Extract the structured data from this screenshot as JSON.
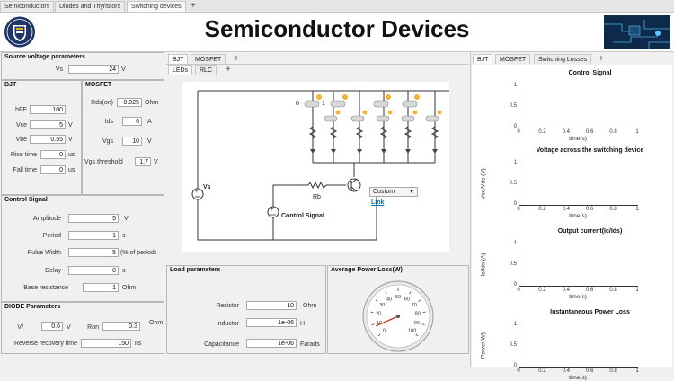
{
  "top_tabs": [
    "Semiconductors",
    "Diodes and Thyristors",
    "Switching devices"
  ],
  "header": {
    "title": "Semiconductor Devices"
  },
  "source": {
    "title": "Source voltage parameters",
    "vs_label": "Vs",
    "vs_value": "24",
    "vs_unit": "V"
  },
  "bjt": {
    "title": "BJT",
    "fields": [
      {
        "label": "hFE",
        "value": "100",
        "unit": ""
      },
      {
        "label": "Vce",
        "value": "5",
        "unit": "V"
      },
      {
        "label": "Vbe",
        "value": "0.55",
        "unit": "V"
      },
      {
        "label": "Rise time",
        "value": "0",
        "unit": "us"
      },
      {
        "label": "Fall time",
        "value": "0",
        "unit": "us"
      }
    ]
  },
  "mosfet": {
    "title": "MOSFET",
    "fields": [
      {
        "label": "Rds(on)",
        "value": "0.025",
        "unit": "Ohm"
      },
      {
        "label": "Ids",
        "value": "6",
        "unit": "A"
      },
      {
        "label": "Vgs",
        "value": "10",
        "unit": "V"
      },
      {
        "label": "Vgs  threshold",
        "value": "1.7",
        "unit": "V"
      }
    ]
  },
  "control_signal": {
    "title": "Control Signal",
    "fields": [
      {
        "label": "Amplitude",
        "value": "5",
        "unit": "V"
      },
      {
        "label": "Period",
        "value": "1",
        "unit": "s"
      },
      {
        "label": "Pulse Width",
        "value": "5",
        "unit": "(% of period)"
      },
      {
        "label": "Delay",
        "value": "0",
        "unit": "s"
      },
      {
        "label": "Base resistance",
        "value": "1",
        "unit": "Ohm"
      }
    ]
  },
  "diode": {
    "title": "DIODE Parameters",
    "vf_label": "Vf",
    "vf_value": "0.6",
    "vf_unit": "V",
    "ron_label": "Ron",
    "ron_value": "0.3",
    "ron_unit": "Ohm",
    "rrt_label": "Reverse recovery time",
    "rrt_value": "150",
    "rrt_unit": "ns"
  },
  "circuit_tabs": {
    "level1": [
      "BJT",
      "MOSFET"
    ],
    "level2": [
      "LEDs",
      "RLC"
    ]
  },
  "circuit": {
    "vs_label": "Vs",
    "rb_label": "Rb",
    "control_label": "Control Signal",
    "dropdown_value": "Custom",
    "link_text": "Link",
    "switch_zero": "0",
    "switch_one": "1"
  },
  "load": {
    "title": "Load parameters",
    "fields": [
      {
        "label": "Resistor",
        "value": "10",
        "unit": "Ohm"
      },
      {
        "label": "Inductor",
        "value": "1e-06",
        "unit": "H"
      },
      {
        "label": "Capacitance",
        "value": "1e-06",
        "unit": "Farads"
      }
    ]
  },
  "power": {
    "title": "Average Power Loss(W)",
    "gauge_labels": [
      "0",
      "10",
      "20",
      "30",
      "40",
      "50",
      "60",
      "70",
      "80",
      "90",
      "100"
    ],
    "gauge_value": 8,
    "gauge_min": 0,
    "gauge_max": 100
  },
  "right_tabs": [
    "BJT",
    "MOSFET",
    "Switching Losses"
  ],
  "plots": [
    {
      "title": "Control Signal",
      "ylabel": "",
      "yticks": [
        "1",
        "0.5",
        "0"
      ],
      "xticks": [
        "0",
        "0.2",
        "0.4",
        "0.6",
        "0.8",
        "1"
      ],
      "xlabel": "time(s)"
    },
    {
      "title": "Voltage across the switching device",
      "ylabel": "Vce/Vds (V)",
      "yticks": [
        "1",
        "0.5",
        "0"
      ],
      "xticks": [
        "0",
        "0.2",
        "0.4",
        "0.6",
        "0.8",
        "1"
      ],
      "xlabel": "time(s)"
    },
    {
      "title": "Output current(Ic/Ids)",
      "ylabel": "Ic/Ids (A)",
      "yticks": [
        "1",
        "0.5",
        "0"
      ],
      "xticks": [
        "0",
        "0.2",
        "0.4",
        "0.6",
        "0.8",
        "1"
      ],
      "xlabel": "time(s)"
    },
    {
      "title": "Instantaneous Power Loss",
      "ylabel": "Power(W)",
      "yticks": [
        "1",
        "0.5",
        "0"
      ],
      "xticks": [
        "0",
        "0.2",
        "0.4",
        "0.6",
        "0.8",
        "1"
      ],
      "xlabel": "time(s)"
    }
  ],
  "colors": {
    "accent": "#0072bd",
    "header_bg": "#ffffff",
    "logo_navy": "#1e3565",
    "needle": "#c0392b"
  }
}
